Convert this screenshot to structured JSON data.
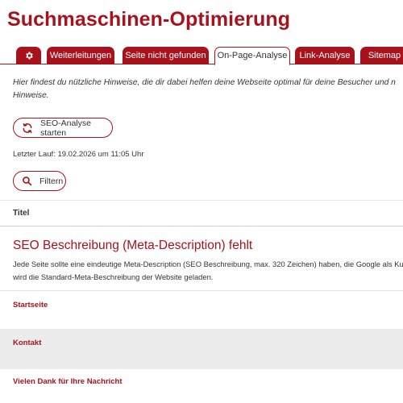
{
  "page": {
    "title": "Suchmaschinen-Optimierung"
  },
  "tabs": [
    {
      "label": "",
      "icon": "gear-icon",
      "active": false
    },
    {
      "label": "Weiterleitungen",
      "active": false
    },
    {
      "label": "Seite nicht gefunden",
      "active": false
    },
    {
      "label": "On-Page-Analyse",
      "active": true
    },
    {
      "label": "Link-Analyse",
      "active": false
    },
    {
      "label": "Sitemap",
      "active": false
    }
  ],
  "intro": {
    "line1": "Hier findest du nützliche Hinweise, die dir dabei helfen deine Webseite optimal für deine Besucher und n",
    "line2": "Hinweise."
  },
  "actions": {
    "seo_button_label": "SEO-Analyse starten",
    "seo_button_icon": "refresh-icon",
    "last_run": "Letzter Lauf: 19.02.2026 um 11:05 Uhr",
    "filter_button_label": "Filtern",
    "filter_button_icon": "search-icon"
  },
  "table": {
    "column_title": "Titel"
  },
  "issue": {
    "title": "SEO Beschreibung (Meta-Description) fehlt",
    "description_line1": "Jede Seite sollte eine eindeutige Meta-Description (SEO Beschreibung, max. 320 Zeichen) haben, die Google als Ku",
    "description_line2": "wird die Standard-Meta-Beschreibung der Website geladen.",
    "pages": [
      "Startseite",
      "Kontakt",
      "Vielen Dank für Ihre Nachricht"
    ]
  },
  "colors": {
    "accent": "#a8121d",
    "row_alt": "#ececec",
    "text": "#333333"
  }
}
